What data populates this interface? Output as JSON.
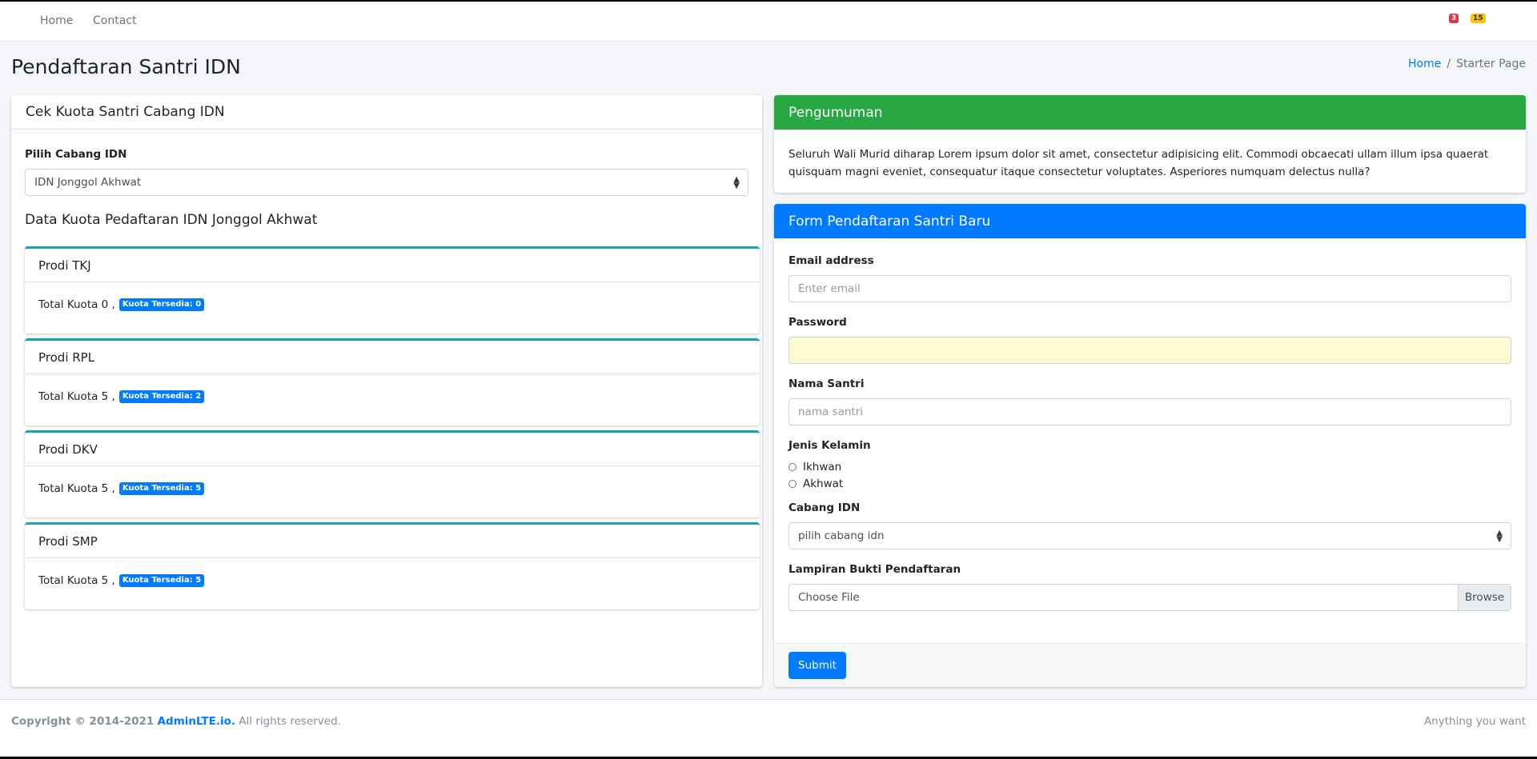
{
  "navbar": {
    "links": [
      "Home",
      "Contact"
    ],
    "badges": [
      {
        "value": "3",
        "color": "#dc3545"
      },
      {
        "value": "15",
        "color": "#ffc107"
      }
    ]
  },
  "header": {
    "title": "Pendaftaran Santri IDN",
    "breadcrumb": {
      "home": "Home",
      "separator": "/",
      "current": "Starter Page"
    }
  },
  "quota_card": {
    "title": "Cek Kuota Santri Cabang IDN",
    "select_label": "Pilih Cabang IDN",
    "select_value": "IDN Jonggol Akhwat",
    "section_title": "Data Kuota Pedaftaran IDN Jonggol Akhwat",
    "programs": [
      {
        "name": "Prodi TKJ",
        "total_text": "Total Kuota 0 ,",
        "badge": "Kuota Tersedia: 0"
      },
      {
        "name": "Prodi RPL",
        "total_text": "Total Kuota 5 ,",
        "badge": "Kuota Tersedia: 2"
      },
      {
        "name": "Prodi DKV",
        "total_text": "Total Kuota 5 ,",
        "badge": "Kuota Tersedia: 5"
      },
      {
        "name": "Prodi SMP",
        "total_text": "Total Kuota 5 ,",
        "badge": "Kuota Tersedia: 5"
      }
    ]
  },
  "announcement": {
    "title": "Pengumuman",
    "body": "Seluruh Wali Murid diharap Lorem ipsum dolor sit amet, consectetur adipisicing elit. Commodi obcaecati ullam illum ipsa quaerat quisquam magni eveniet, consequatur itaque consectetur voluptates. Asperiores numquam delectus nulla?"
  },
  "form": {
    "title": "Form Pendaftaran Santri Baru",
    "email": {
      "label": "Email address",
      "placeholder": "Enter email",
      "value": ""
    },
    "password": {
      "label": "Password",
      "value": ""
    },
    "nama": {
      "label": "Nama Santri",
      "placeholder": "nama santri",
      "value": ""
    },
    "gender": {
      "label": "Jenis Kelamin",
      "options": [
        "Ikhwan",
        "Akhwat"
      ]
    },
    "cabang": {
      "label": "Cabang IDN",
      "value": "pilih cabang idn"
    },
    "lampiran": {
      "label": "Lampiran Bukti Pendaftaran",
      "text": "Choose File",
      "browse": "Browse"
    },
    "submit": "Submit"
  },
  "footer": {
    "copyright": "Copyright © 2014-2021",
    "brand": "AdminLTE.io.",
    "rights": "All rights reserved.",
    "right_text": "Anything you want"
  },
  "colors": {
    "primary": "#007bff",
    "success": "#28a745",
    "info": "#17a2b8",
    "danger": "#dc3545",
    "warning": "#ffc107"
  }
}
